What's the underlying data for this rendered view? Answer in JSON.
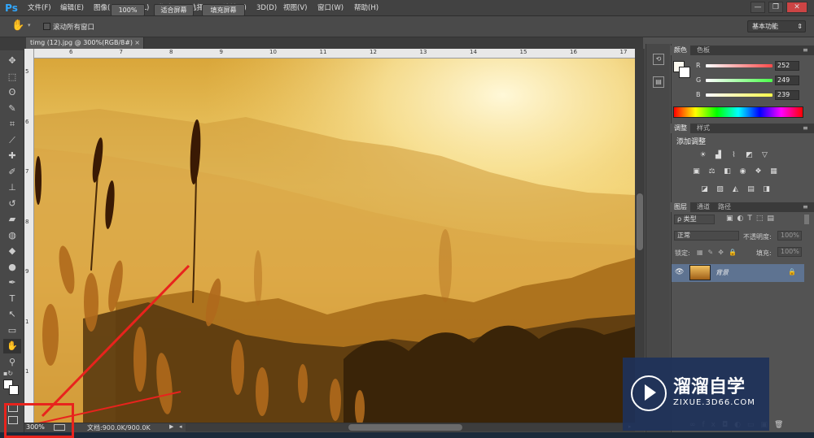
{
  "app": {
    "logo": "Ps"
  },
  "menu": [
    "文件(F)",
    "编辑(E)",
    "图像(I)",
    "图层(L)",
    "类型(Y)",
    "选择(S)",
    "滤镜(T)",
    "3D(D)",
    "视图(V)",
    "窗口(W)",
    "帮助(H)"
  ],
  "window_buttons": [
    "—",
    "❐",
    "✕"
  ],
  "options": {
    "scroll_all": "滚动所有窗口",
    "zoom100": "100%",
    "fit_screen": "适合屏幕",
    "fill_screen": "填充屏幕",
    "workspace": "基本功能"
  },
  "document": {
    "tab_title": "timg (12).jpg @ 300%(RGB/8#)",
    "close": "×"
  },
  "ruler": {
    "top": [
      "6",
      "7",
      "8",
      "9",
      "10",
      "11",
      "12",
      "13",
      "14",
      "15",
      "16",
      "17"
    ],
    "left": [
      "5",
      "6",
      "7",
      "8",
      "9",
      "1",
      "1"
    ]
  },
  "status": {
    "zoom": "300%",
    "doc_info": "文档:900.0K/900.0K"
  },
  "color_panel": {
    "tabs": [
      "颜色",
      "色板"
    ],
    "channels": [
      {
        "label": "R",
        "value": "252",
        "color": "#ff4a4a"
      },
      {
        "label": "G",
        "value": "249",
        "color": "#4aff4a"
      },
      {
        "label": "B",
        "value": "239",
        "color": "#ffff4a"
      }
    ]
  },
  "adjust_panel": {
    "tabs": [
      "调整",
      "样式"
    ],
    "title": "添加调整",
    "icons": [
      [
        "brightness-icon",
        "levels-icon",
        "curves-icon",
        "exposure-icon",
        "triangle-icon"
      ],
      [
        "vibrance-icon",
        "balance-icon",
        "bw-icon",
        "photofilter-icon",
        "channelmix-icon",
        "lookup-icon"
      ],
      [
        "invert-icon",
        "posterize-icon",
        "threshold-icon",
        "gradientmap-icon",
        "selective-icon"
      ]
    ]
  },
  "layers_panel": {
    "tabs": [
      "图层",
      "通道",
      "路径"
    ],
    "filter": "ρ 类型",
    "blend_mode": "正常",
    "opacity_label": "不透明度:",
    "opacity": "100%",
    "lock_label": "锁定:",
    "fill_label": "填充:",
    "fill": "100%",
    "layer_name": "背景"
  },
  "watermark": {
    "title": "溜溜自学",
    "url": "ZIXUE.3D66.COM"
  },
  "colors": {
    "accent": "#31a8ff",
    "highlight": "#e8231d",
    "layer_selected": "#5e7391"
  }
}
